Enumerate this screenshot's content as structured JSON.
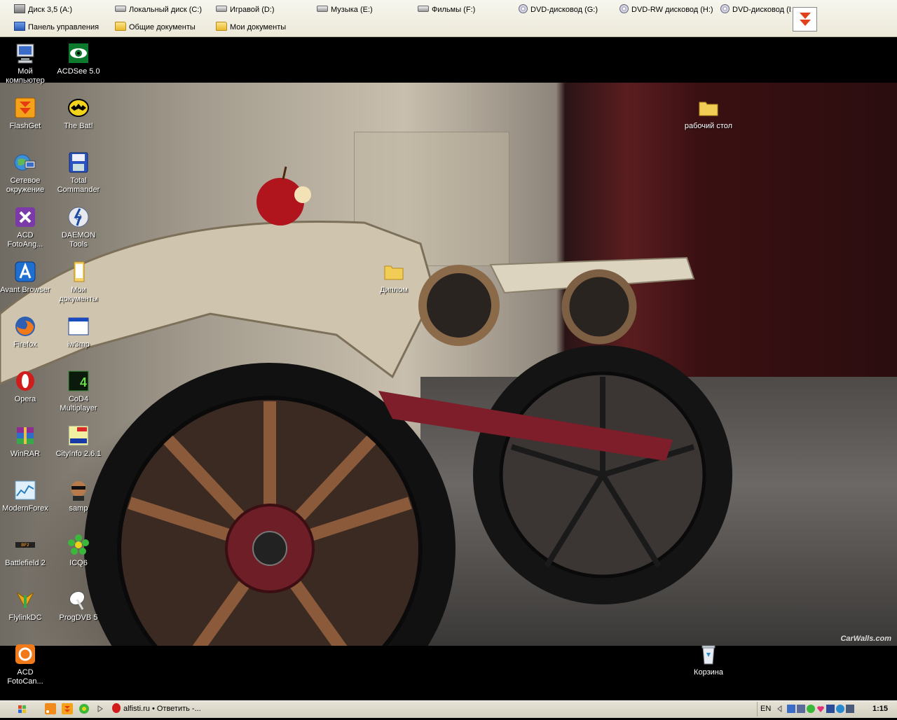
{
  "toolbar": {
    "drives": [
      {
        "label": "Диск 3,5 (A:)",
        "icon": "floppy-icon"
      },
      {
        "label": "Локальный диск (C:)",
        "icon": "hard-drive-icon"
      },
      {
        "label": "Игравой (D:)",
        "icon": "hard-drive-icon"
      },
      {
        "label": "Музыка (E:)",
        "icon": "hard-drive-icon"
      },
      {
        "label": "Фильмы (F:)",
        "icon": "hard-drive-icon"
      },
      {
        "label": "DVD-дисковод (G:)",
        "icon": "dvd-icon"
      },
      {
        "label": "DVD-RW дисковод (H:)",
        "icon": "dvd-icon"
      },
      {
        "label": "DVD-дисковод (I:",
        "icon": "dvd-icon"
      }
    ],
    "links": [
      {
        "label": "Панель управления",
        "icon": "control-panel-icon"
      },
      {
        "label": "Общие документы",
        "icon": "folder-icon"
      },
      {
        "label": "Мои документы",
        "icon": "folder-icon"
      }
    ]
  },
  "desktop": {
    "icons": [
      {
        "label": "Мой компьютер",
        "icon": "my-computer-icon"
      },
      {
        "label": "ACDSee 5.0",
        "icon": "acdsee-icon"
      },
      {
        "label": "FlashGet",
        "icon": "flashget-icon"
      },
      {
        "label": "The Bat!",
        "icon": "the-bat-icon"
      },
      {
        "label": "Сетевое окружение",
        "icon": "network-icon"
      },
      {
        "label": "Total Commander",
        "icon": "total-commander-icon"
      },
      {
        "label": "ACD FotoAng...",
        "icon": "acd-fotoangelo-icon"
      },
      {
        "label": "DAEMON Tools",
        "icon": "daemon-tools-icon"
      },
      {
        "label": "Avant Browser",
        "icon": "avant-browser-icon"
      },
      {
        "label": "Мои документы",
        "icon": "my-documents-icon"
      },
      {
        "label": "Firefox",
        "icon": "firefox-icon"
      },
      {
        "label": "iw3mp",
        "icon": "application-icon"
      },
      {
        "label": "Opera",
        "icon": "opera-icon"
      },
      {
        "label": "CoD4 Multiplayer",
        "icon": "cod4-icon"
      },
      {
        "label": "WinRAR",
        "icon": "winrar-icon"
      },
      {
        "label": "CityInfo 2.6.1",
        "icon": "cityinfo-icon"
      },
      {
        "label": "ModernForex",
        "icon": "modernforex-icon"
      },
      {
        "label": "samp",
        "icon": "samp-icon"
      },
      {
        "label": "Battlefield 2",
        "icon": "battlefield-icon"
      },
      {
        "label": "ICQ6",
        "icon": "icq-icon"
      },
      {
        "label": "FlylinkDC",
        "icon": "flylinkdc-icon"
      },
      {
        "label": "ProgDVB 5",
        "icon": "progdvb-icon"
      },
      {
        "label": "ACD FotoCan...",
        "icon": "acd-fotocanvas-icon"
      },
      {
        "label": "Диплом",
        "icon": "folder-icon"
      },
      {
        "label": "рабочий стол",
        "icon": "folder-icon"
      },
      {
        "label": "Корзина",
        "icon": "recycle-bin-icon"
      }
    ],
    "wallpaper_watermark": "CarWalls.com"
  },
  "taskbar": {
    "task_title": "alfisti.ru • Ответить -...",
    "language": "EN",
    "clock": "1:15"
  },
  "colors": {
    "taskbar": "#d6d2c2",
    "toolbar": "#ece9d8",
    "desktop": "#000000"
  }
}
